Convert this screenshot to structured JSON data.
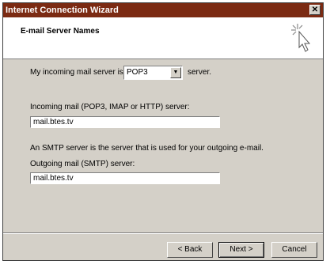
{
  "window": {
    "title": "Internet Connection Wizard",
    "close_glyph": "✕"
  },
  "header": {
    "title": "E-mail Server Names"
  },
  "incoming_type": {
    "prefix": "My incoming mail server is a",
    "selected": "POP3",
    "suffix": "server."
  },
  "incoming": {
    "label": "Incoming mail (POP3, IMAP or HTTP) server:",
    "value": "mail.btes.tv"
  },
  "smtp_info": "An SMTP server is the server that is used for your outgoing e-mail.",
  "outgoing": {
    "label": "Outgoing mail (SMTP) server:",
    "value": "mail.btes.tv"
  },
  "buttons": {
    "back": "< Back",
    "next": "Next >",
    "cancel": "Cancel"
  }
}
